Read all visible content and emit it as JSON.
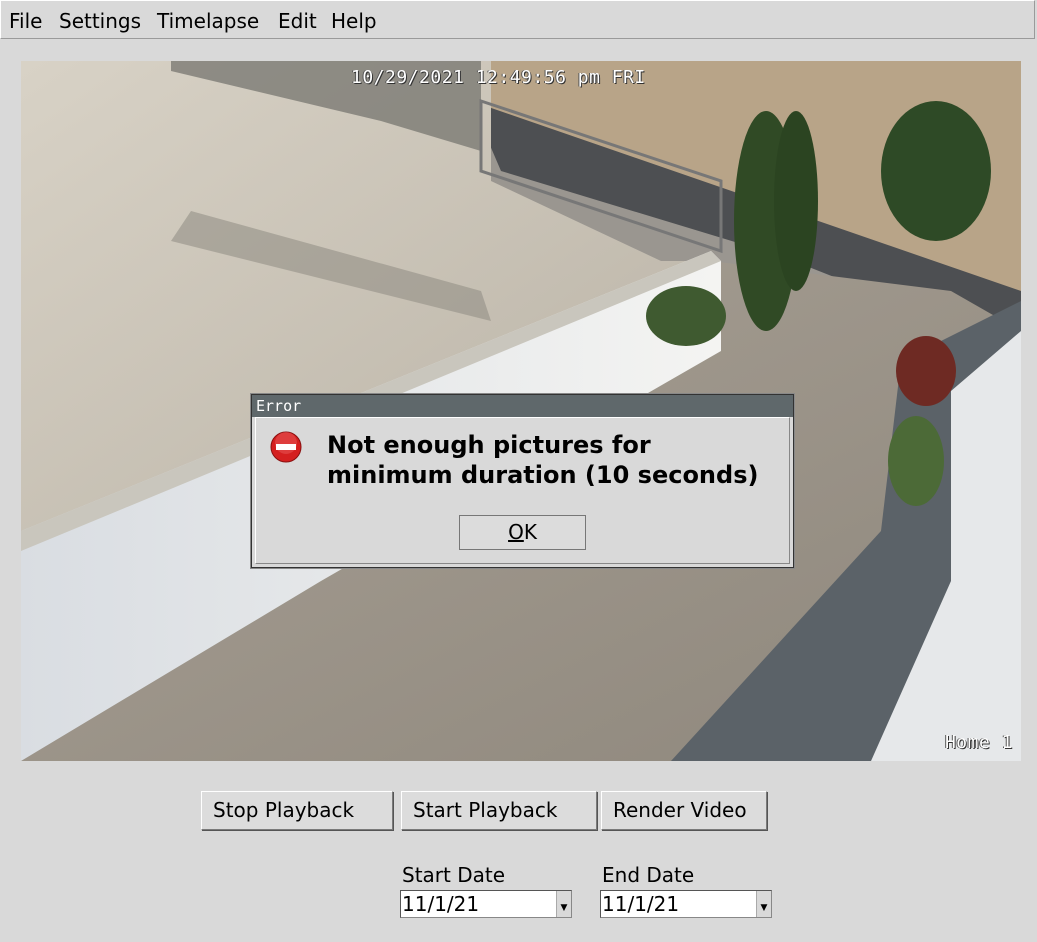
{
  "menu": {
    "file": "File",
    "settings": "Settings",
    "timelapse": "Timelapse",
    "edit": "Edit",
    "help": "Help"
  },
  "camera": {
    "timestamp": "10/29/2021 12:49:56 pm FRI",
    "label": "Home 1"
  },
  "dialog": {
    "title": "Error",
    "message": "Not enough pictures for\nminimum duration (10 seconds)",
    "ok_mnemonic": "O",
    "ok_rest": "K",
    "icon": "error-icon"
  },
  "controls": {
    "stop_playback": "Stop Playback",
    "start_playback": "Start Playback",
    "render_video": "Render Video"
  },
  "dates": {
    "start_label": "Start Date",
    "start_value": "11/1/21",
    "end_label": "End Date",
    "end_value": "11/1/21"
  },
  "colors": {
    "window_bg": "#d9d9d9",
    "dialog_titlebar": "#5f686b",
    "error_red": "#d42020"
  }
}
